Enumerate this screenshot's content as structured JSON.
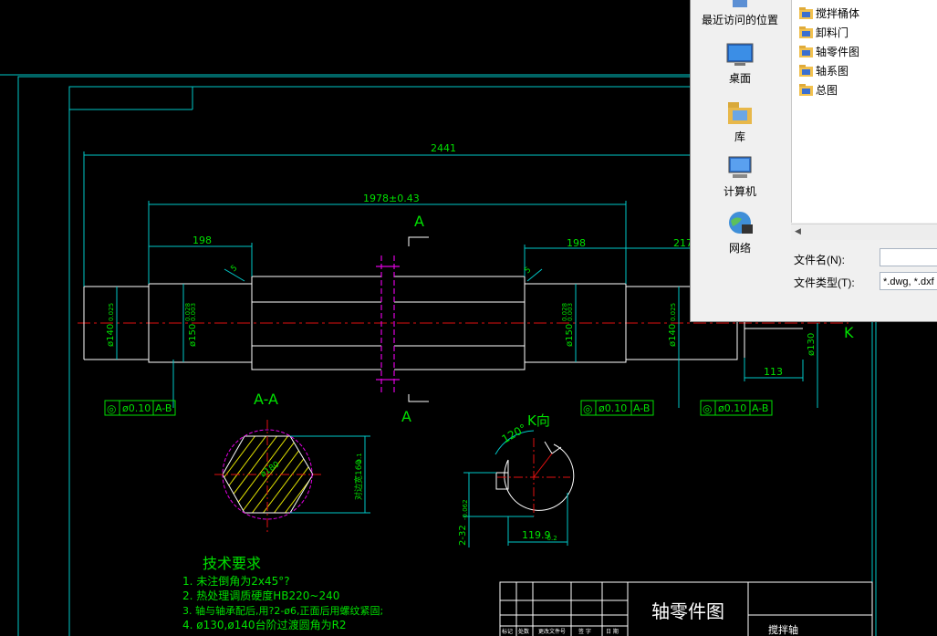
{
  "drawing": {
    "dims": {
      "overall": "2441",
      "middle": "1978±0.43",
      "left_step": "198",
      "right_step": "198",
      "right_len": "217",
      "k_len": "113",
      "chamfer_l": "5",
      "chamfer_r": "5"
    },
    "diameters": {
      "d1": "ø140",
      "d1_tol": "0.025",
      "d2": "ø150",
      "d2_tol_a": "0.028",
      "d2_tol_b": "0.003",
      "d3": "ø150",
      "d3_tol_a": "0.028",
      "d3_tol_b": "0.003",
      "d4": "ø140",
      "d4_tol": "0.025",
      "d5": "ø130"
    },
    "section_labels": {
      "a_top": "A",
      "a_bottom": "A",
      "aa": "A-A",
      "k": "K",
      "k_view": "K向"
    },
    "tolerance_frames": [
      {
        "symbol": "◎",
        "value": "ø0.10",
        "datum": "A-B"
      },
      {
        "symbol": "◎",
        "value": "ø0.10",
        "datum": "A-B"
      },
      {
        "symbol": "◎",
        "value": "ø0.10",
        "datum": "A-B"
      }
    ],
    "section_aa": {
      "inner": "ø180",
      "across_flats": "对边宽160",
      "across_tol": "-0.1"
    },
    "k_view": {
      "angle": "120°",
      "keyway_depth": "2-32",
      "keyway_tol": "-0.062",
      "width": "119.9",
      "width_tol": "-0.2"
    },
    "tech_req": {
      "title": "技术要求",
      "items": [
        "1. 未注倒角为2x45°?",
        "2. 热处理调质硬度HB220~240",
        "3. 轴与轴承配后,用?2-ø6,正面后用螺纹紧固;",
        "4. ø130,ø140台阶过渡圆角为R2"
      ]
    },
    "title_block": {
      "name": "轴零件图",
      "part": "搅拌轴",
      "cols": [
        "标记",
        "处数",
        "更改文件号",
        "签 字",
        "日 期"
      ]
    }
  },
  "dialog": {
    "places": [
      {
        "label": "最近访问的位置",
        "icon": "recent-places-icon"
      },
      {
        "label": "桌面",
        "icon": "desktop-icon"
      },
      {
        "label": "库",
        "icon": "libraries-icon"
      },
      {
        "label": "计算机",
        "icon": "computer-icon"
      },
      {
        "label": "网络",
        "icon": "network-icon"
      }
    ],
    "files": [
      "搅拌桶体",
      "卸料门",
      "轴零件图",
      "轴系图",
      "总图"
    ],
    "filename_label": "文件名(N):",
    "filename_value": "",
    "filetype_label": "文件类型(T):",
    "filetype_value": "*.dwg, *.dxf"
  }
}
